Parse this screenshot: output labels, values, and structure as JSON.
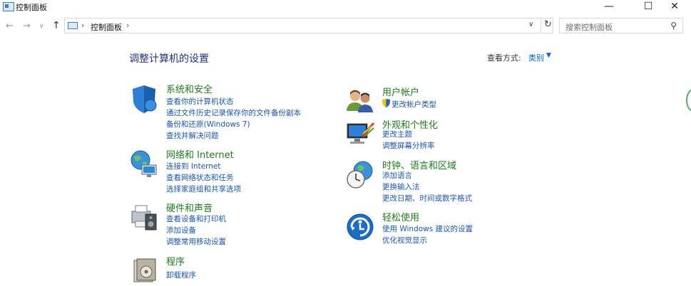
{
  "window": {
    "title": "控制面板"
  },
  "nav": {
    "address": "控制面板",
    "search_placeholder": "搜索控制面板"
  },
  "header": {
    "title": "调整计算机的设置",
    "view_by_label": "查看方式:",
    "view_by_value": "类别"
  },
  "categories": {
    "system": {
      "title": "系统和安全",
      "links": [
        "查看你的计算机状态",
        "通过文件历史记录保存你的文件备份副本",
        "备份和还原(Windows 7)",
        "查找并解决问题"
      ]
    },
    "network": {
      "title": "网络和 Internet",
      "links": [
        "连接到 Internet",
        "查看网络状态和任务",
        "选择家庭组和共享选项"
      ]
    },
    "hardware": {
      "title": "硬件和声音",
      "links": [
        "查看设备和打印机",
        "添加设备",
        "调整常用移动设置"
      ]
    },
    "programs": {
      "title": "程序",
      "links": [
        "卸载程序"
      ]
    },
    "users": {
      "title": "用户帐户",
      "links": [
        "更改帐户类型"
      ]
    },
    "appearance": {
      "title": "外观和个性化",
      "links": [
        "更改主题",
        "调整屏幕分辨率"
      ]
    },
    "clock": {
      "title": "时钟、语言和区域",
      "links": [
        "添加语言",
        "更换输入法",
        "更改日期、时间或数字格式"
      ]
    },
    "ease": {
      "title": "轻松使用",
      "links": [
        "使用 Windows 建议的设置",
        "优化视觉显示"
      ]
    }
  }
}
